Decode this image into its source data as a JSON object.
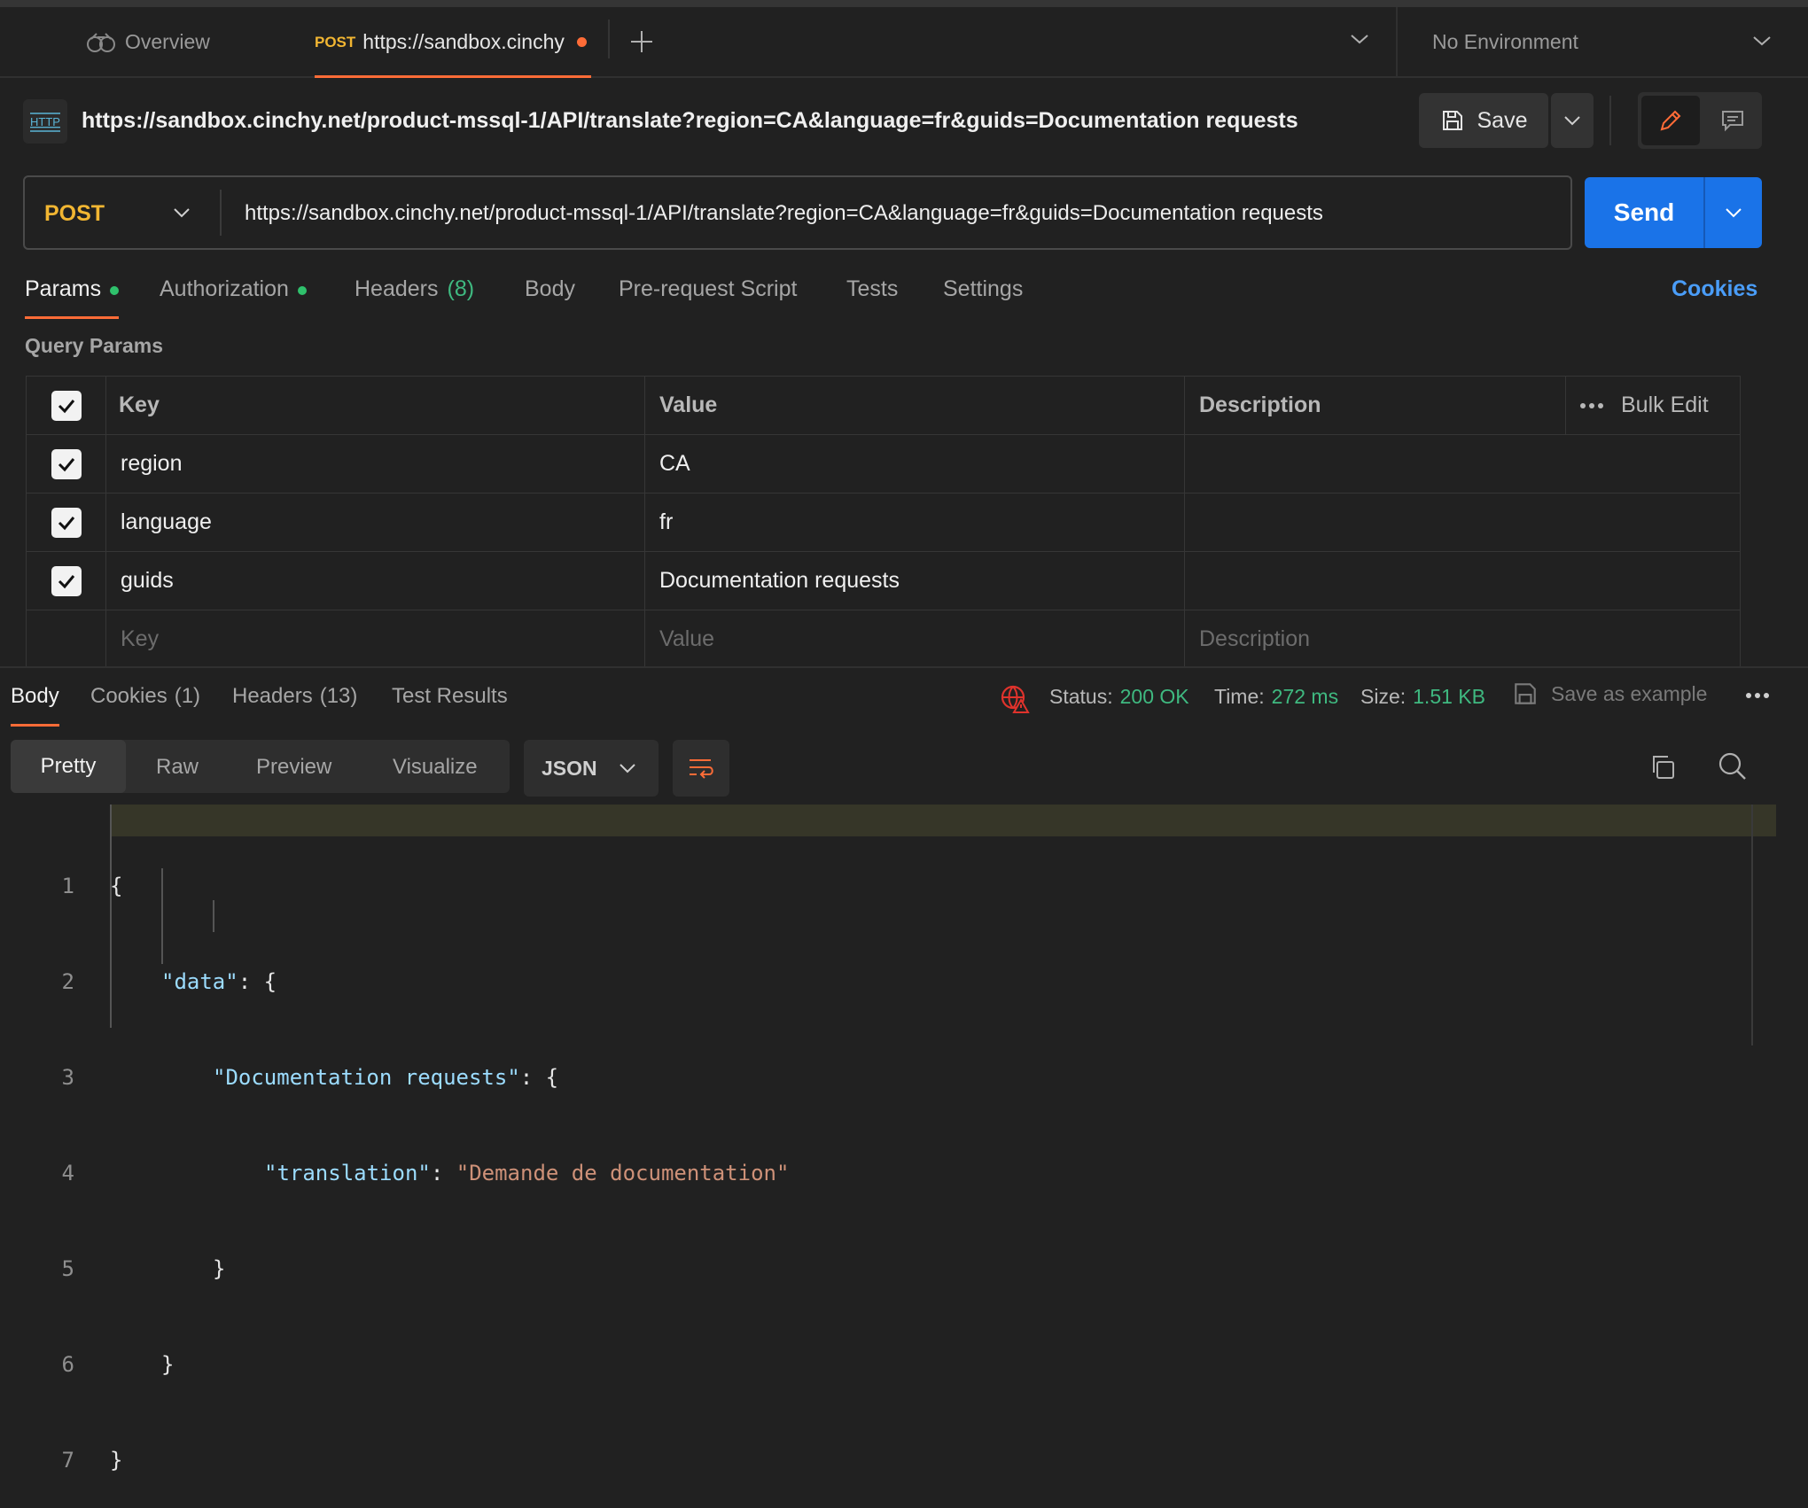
{
  "tabs": {
    "overview_label": "Overview",
    "active_method": "POST",
    "active_title": "https://sandbox.cinchy",
    "environment": "No Environment"
  },
  "request": {
    "header_url": "https://sandbox.cinchy.net/product-mssql-1/API/translate?region=CA&language=fr&guids=Documentation requests",
    "save_label": "Save",
    "method": "POST",
    "url": "https://sandbox.cinchy.net/product-mssql-1/API/translate?region=CA&language=fr&guids=Documentation requests",
    "send_label": "Send"
  },
  "request_tabs": {
    "params": "Params",
    "authorization": "Authorization",
    "headers": "Headers",
    "headers_count": "(8)",
    "body": "Body",
    "prerequest": "Pre-request Script",
    "tests": "Tests",
    "settings": "Settings",
    "cookies": "Cookies"
  },
  "query_params": {
    "title": "Query Params",
    "headers": {
      "key": "Key",
      "value": "Value",
      "description": "Description",
      "bulk_edit": "Bulk Edit"
    },
    "rows": [
      {
        "key": "region",
        "value": "CA",
        "description": ""
      },
      {
        "key": "language",
        "value": "fr",
        "description": ""
      },
      {
        "key": "guids",
        "value": "Documentation requests",
        "description": ""
      }
    ],
    "placeholders": {
      "key": "Key",
      "value": "Value",
      "description": "Description"
    }
  },
  "response": {
    "tabs": {
      "body": "Body",
      "cookies": "Cookies",
      "cookies_count": "(1)",
      "headers": "Headers",
      "headers_count": "(13)",
      "test_results": "Test Results"
    },
    "status_label": "Status:",
    "status_value": "200 OK",
    "time_label": "Time:",
    "time_value": "272 ms",
    "size_label": "Size:",
    "size_value": "1.51 KB",
    "save_example": "Save as example",
    "views": {
      "pretty": "Pretty",
      "raw": "Raw",
      "preview": "Preview",
      "visualize": "Visualize"
    },
    "format": "JSON",
    "code": {
      "line_numbers": [
        "1",
        "2",
        "3",
        "4",
        "5",
        "6",
        "7"
      ],
      "open_brace": "{",
      "key_data": "\"data\"",
      "colon_brace": ": {",
      "key_doc": "\"Documentation requests\"",
      "key_translation": "\"translation\"",
      "colon": ": ",
      "val_translation": "\"Demande de documentation\"",
      "close_brace": "}"
    }
  },
  "colors": {
    "accent_orange": "#ff6c37",
    "send_blue": "#1a73e8",
    "cookies_blue": "#4a9df8",
    "status_green": "#3fb980",
    "method_yellow": "#f2b632"
  }
}
